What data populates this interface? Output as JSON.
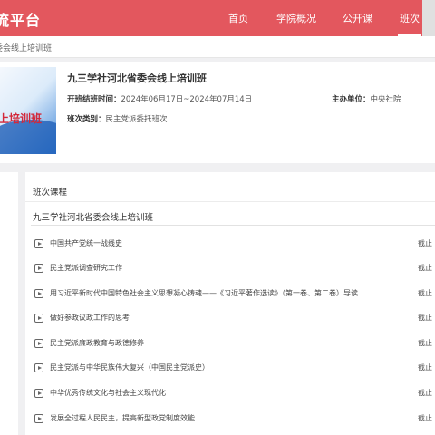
{
  "header": {
    "logo_text": "流平台",
    "nav": [
      {
        "label": "首页"
      },
      {
        "label": "学院概况"
      },
      {
        "label": "公开课"
      },
      {
        "label": "班次"
      }
    ]
  },
  "breadcrumb": {
    "text": "委会线上培训班"
  },
  "course": {
    "cover_text": "线上培训班",
    "title": "九三学社河北省委会线上培训班",
    "time_label": "开班结班时间：",
    "time_value": "2024年06月17日~2024年07月14日",
    "host_label": "主办单位：",
    "host_value": "中央社院",
    "type_label": "班次类别：",
    "type_value": "民主党派委托班次"
  },
  "panel": {
    "title": "班次课程",
    "class_name": "九三学社河北省委会线上培训班",
    "courses": [
      {
        "title": "中国共产党统一战线史",
        "deadline": "截止"
      },
      {
        "title": "民主党派调查研究工作",
        "deadline": "截止"
      },
      {
        "title": "用习近平新时代中国特色社会主义思想凝心铸魂——《习近平著作选读》（第一卷、第二卷）导读",
        "deadline": "截止"
      },
      {
        "title": "做好参政议政工作的思考",
        "deadline": "截止"
      },
      {
        "title": "民主党派廉政教育与政德修养",
        "deadline": "截止"
      },
      {
        "title": "民主党派与中华民族伟大复兴（中国民主党派史）",
        "deadline": "截止"
      },
      {
        "title": "中华优秀传统文化与社会主义现代化",
        "deadline": "截止"
      },
      {
        "title": "发展全过程人民民主，提高新型政党制度效能",
        "deadline": "截止"
      }
    ]
  }
}
